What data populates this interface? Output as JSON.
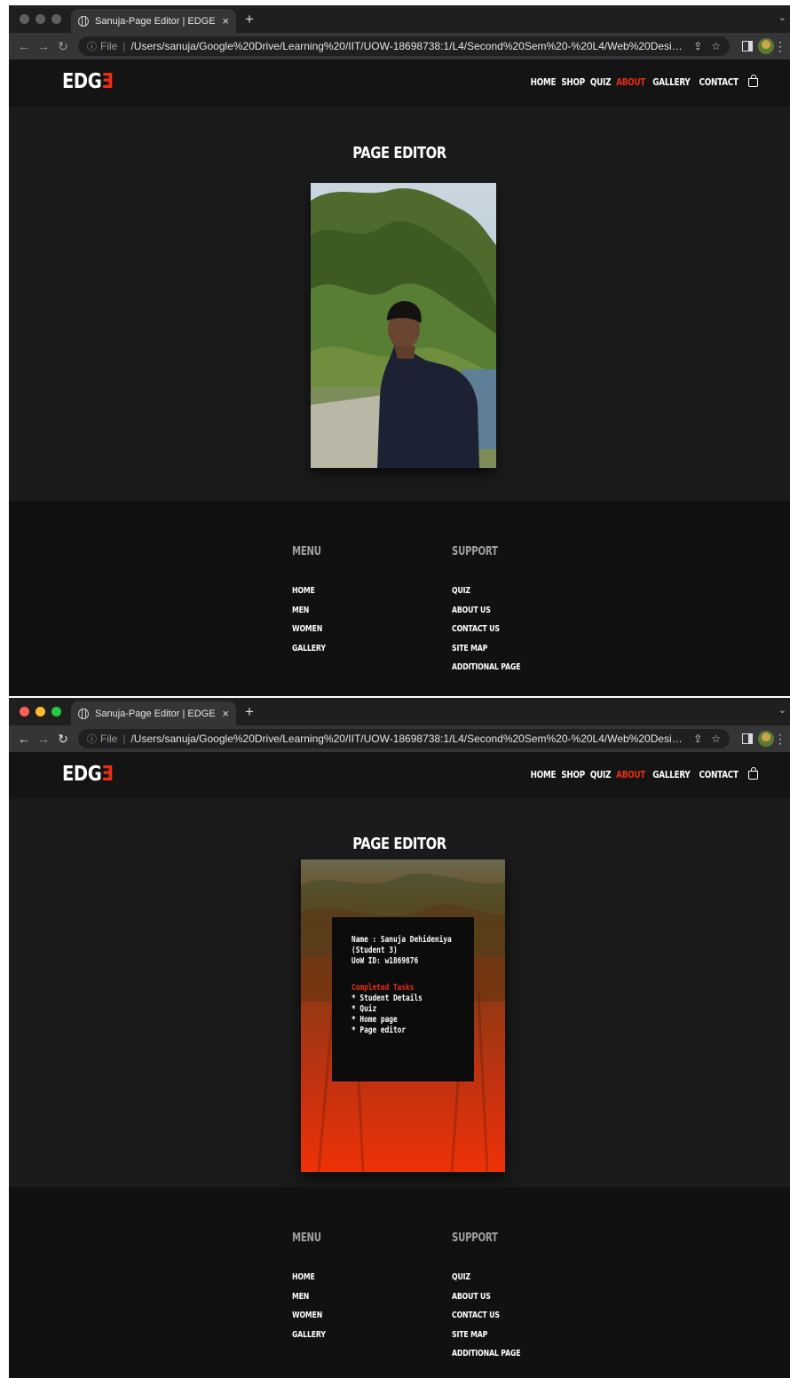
{
  "browser": {
    "tab_title": "Sanuja-Page Editor | EDGE",
    "tab_close": "×",
    "new_tab": "+",
    "file_label": "File",
    "separator": "|",
    "url": "/Users/sanuja/Google%20Drive/Learning%20/IIT/UOW-18698738:1/L4/Second%20Sem%20-%20L4/Web%20Design%..."
  },
  "site": {
    "logo_main": "EDG",
    "logo_accent": "Ǝ",
    "nav": [
      "HOME",
      "SHOP",
      "QUIZ",
      "ABOUT",
      "GALLERY",
      "CONTACT"
    ],
    "active_nav": "ABOUT",
    "accent_color": "#ea2e12"
  },
  "page": {
    "title": "PAGE EDITOR"
  },
  "info_card": {
    "name_line": "Name : Sanuja Dehideniya",
    "student_line": "(Student 3)",
    "uow_line": "UoW ID: w1869876",
    "tasks_title": "Completed Tasks",
    "tasks": [
      "* Student Details",
      "* Quiz",
      "* Home page",
      "* Page editor"
    ]
  },
  "footer": {
    "menu_title": "MENU",
    "menu_links": [
      "HOME",
      "MEN",
      "WOMEN",
      "GALLERY"
    ],
    "support_title": "SUPPORT",
    "support_links": [
      "QUIZ",
      "ABOUT US",
      "CONTACT US",
      "SITE MAP",
      "ADDITIONAL PAGE"
    ]
  },
  "icons": [
    "globe-icon",
    "back-arrow-icon",
    "forward-arrow-icon",
    "reload-icon",
    "info-icon",
    "share-icon",
    "bookmark-star-icon",
    "side-panel-icon",
    "profile-avatar-icon",
    "more-menu-icon",
    "shopping-bag-icon"
  ]
}
